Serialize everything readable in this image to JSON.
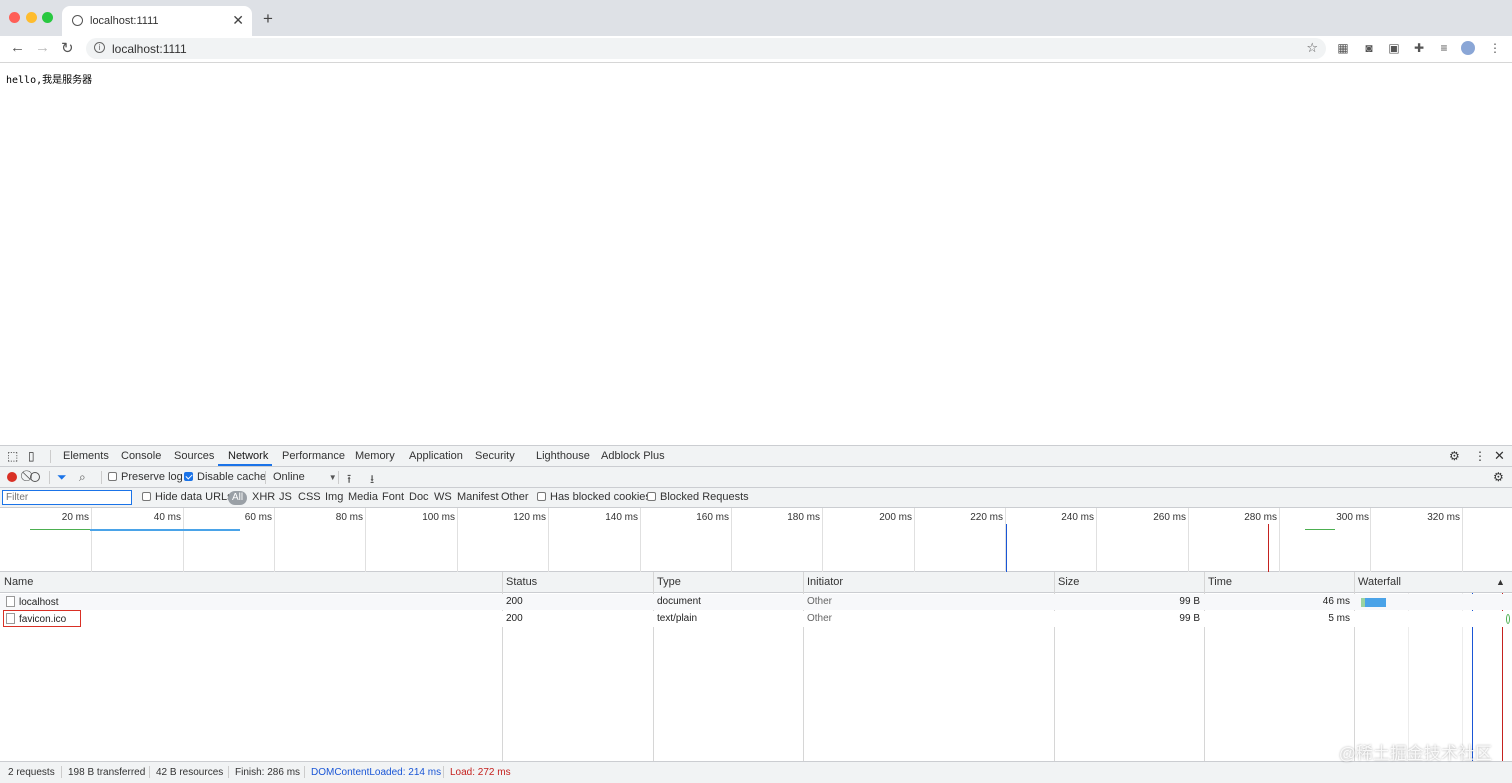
{
  "browser": {
    "tab_title": "localhost:1111",
    "url": "localhost:1111",
    "new_tab_symbol": "+",
    "tab_close_symbol": "✕",
    "traffic_colors": [
      "#ff5f57",
      "#febc2e",
      "#28c840"
    ]
  },
  "page": {
    "text": "hello,我是服务器"
  },
  "devtools": {
    "tabs": [
      "Elements",
      "Console",
      "Sources",
      "Network",
      "Performance",
      "Memory",
      "Application",
      "Security",
      "Lighthouse",
      "Adblock Plus"
    ],
    "active_tab": "Network",
    "toolbar": {
      "preserve_log": "Preserve log",
      "preserve_log_checked": false,
      "disable_cache": "Disable cache",
      "disable_cache_checked": true,
      "throttling": "Online"
    },
    "filterbar": {
      "filter_placeholder": "Filter",
      "hide_data_urls": "Hide data URLs",
      "types": [
        "All",
        "XHR",
        "JS",
        "CSS",
        "Img",
        "Media",
        "Font",
        "Doc",
        "WS",
        "Manifest",
        "Other"
      ],
      "active_type": "All",
      "has_blocked_cookies": "Has blocked cookies",
      "blocked_requests": "Blocked Requests"
    },
    "overview_ticks": [
      "20 ms",
      "40 ms",
      "60 ms",
      "80 ms",
      "100 ms",
      "120 ms",
      "140 ms",
      "160 ms",
      "180 ms",
      "200 ms",
      "220 ms",
      "240 ms",
      "260 ms",
      "280 ms",
      "300 ms",
      "320 ms"
    ],
    "columns": [
      "Name",
      "Status",
      "Type",
      "Initiator",
      "Size",
      "Time",
      "Waterfall"
    ],
    "rows": [
      {
        "name": "localhost",
        "status": "200",
        "type": "document",
        "initiator": "Other",
        "size": "99 B",
        "time": "46 ms"
      },
      {
        "name": "favicon.ico",
        "status": "200",
        "type": "text/plain",
        "initiator": "Other",
        "size": "99 B",
        "time": "5 ms"
      }
    ],
    "status": {
      "requests": "2 requests",
      "transferred": "198 B transferred",
      "resources": "42 B resources",
      "finish": "Finish: 286 ms",
      "dom_content_loaded": "DOMContentLoaded: 214 ms",
      "load": "Load: 272 ms"
    },
    "colors": {
      "dcl": "#1a56d6",
      "load": "#c5221f",
      "record": "#d93025",
      "accent": "#1a73e8"
    }
  },
  "watermark": "@稀土掘金技术社区"
}
